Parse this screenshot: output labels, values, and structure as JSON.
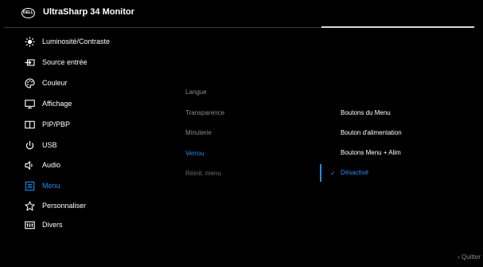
{
  "header": {
    "logo_text": "DELL",
    "title": "UltraSharp 34 Monitor"
  },
  "sidebar": {
    "items": [
      {
        "label": "Luminosité/Contraste",
        "icon": "brightness-icon"
      },
      {
        "label": "Source entrée",
        "icon": "input-source-icon"
      },
      {
        "label": "Couleur",
        "icon": "color-palette-icon"
      },
      {
        "label": "Affichage",
        "icon": "display-icon"
      },
      {
        "label": "PIP/PBP",
        "icon": "pip-pbp-icon"
      },
      {
        "label": "USB",
        "icon": "usb-icon"
      },
      {
        "label": "Audio",
        "icon": "speaker-icon"
      },
      {
        "label": "Menu",
        "icon": "menu-icon",
        "active": true
      },
      {
        "label": "Personnaliser",
        "icon": "star-icon"
      },
      {
        "label": "Divers",
        "icon": "others-icon"
      }
    ]
  },
  "submenu": {
    "items": [
      {
        "label": "Langue"
      },
      {
        "label": "Transparence"
      },
      {
        "label": "Minuterie"
      },
      {
        "label": "Verrou",
        "active": true
      },
      {
        "label": "Réinit. menu"
      }
    ]
  },
  "options": {
    "items": [
      {
        "label": "Boutons du Menu"
      },
      {
        "label": "Bouton d'alimentation"
      },
      {
        "label": "Boutons Menu + Alim"
      },
      {
        "label": "Désactivé",
        "selected": true
      }
    ],
    "check_mark": "✓"
  },
  "footer": {
    "exit_label": "‹ Quitter"
  },
  "colors": {
    "background": "#000000",
    "accent": "#1f8ff0",
    "text": "#ffffff",
    "dim_text": "#8a8a8a"
  }
}
